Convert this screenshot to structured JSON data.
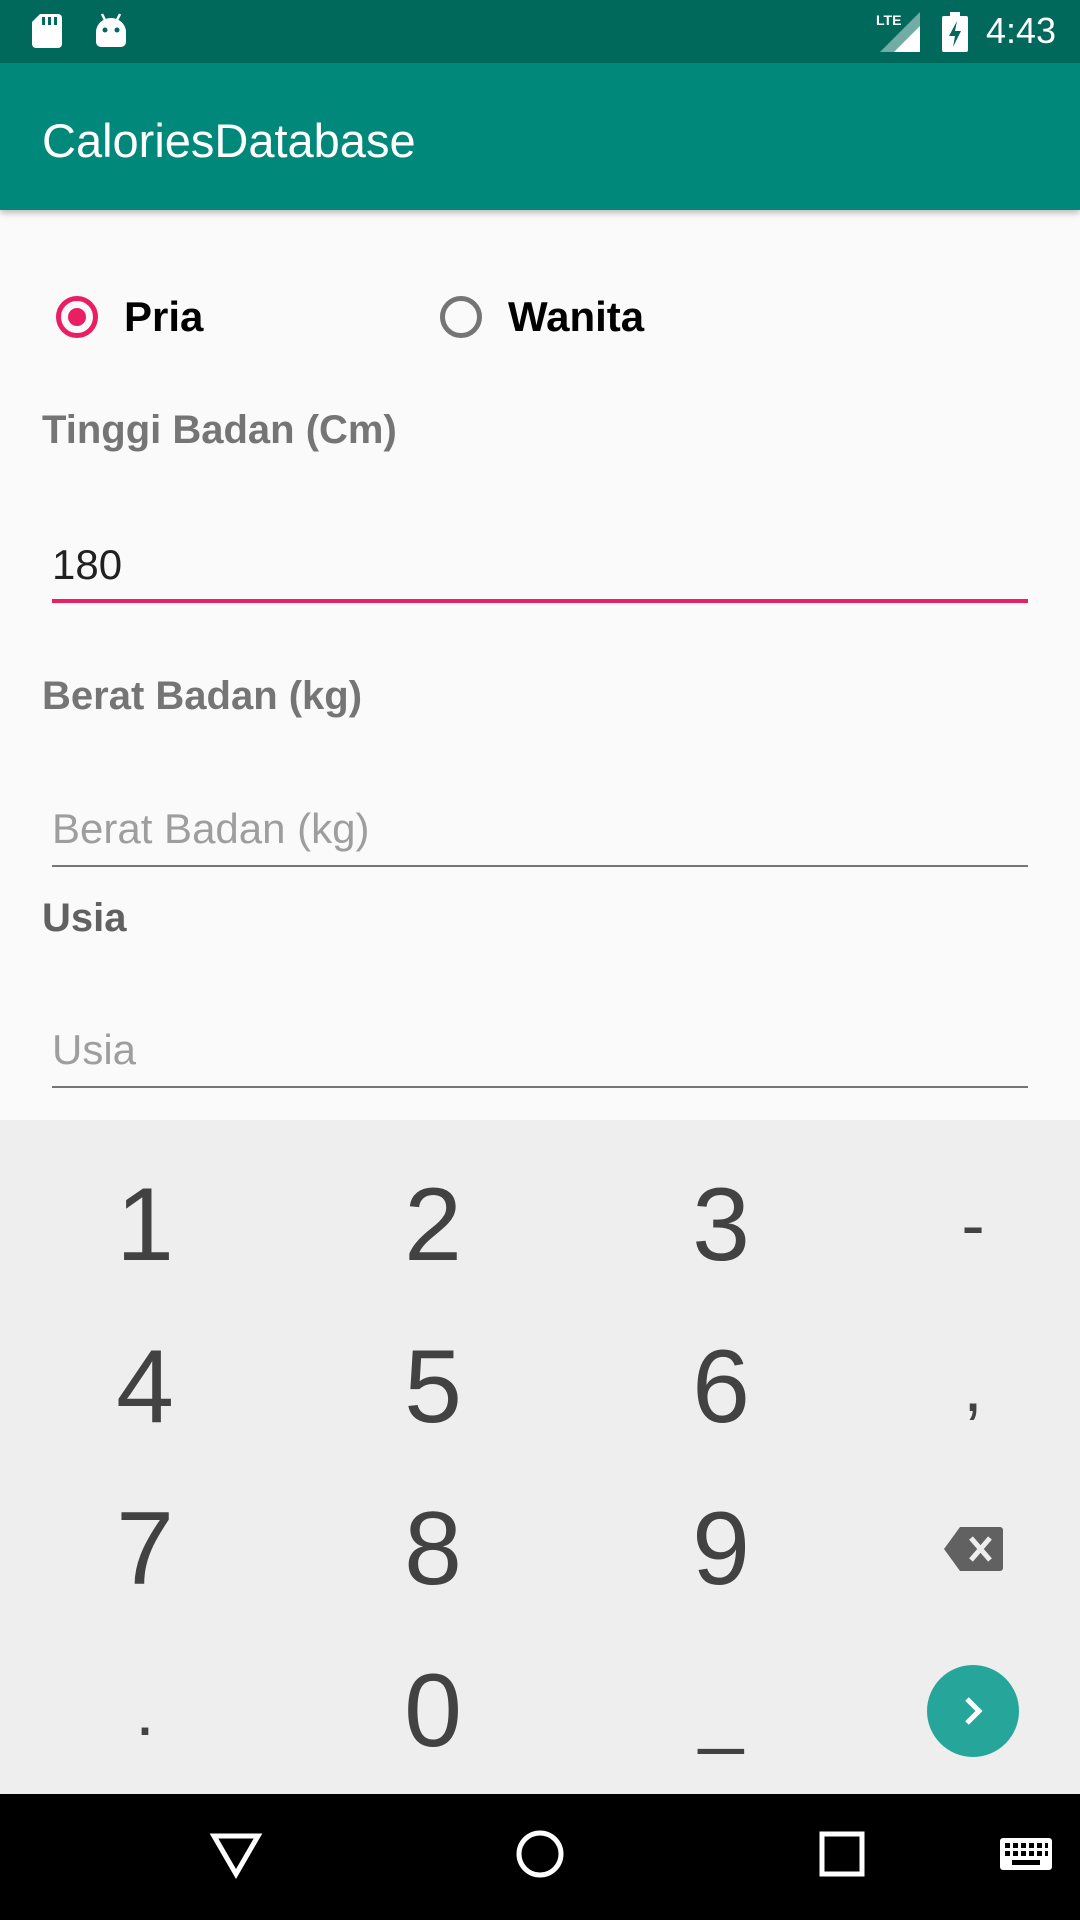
{
  "status_bar": {
    "time": "4:43",
    "network_label": "LTE",
    "icons": [
      "sd-card-icon",
      "android-icon",
      "lte-signal-icon",
      "battery-charging-icon"
    ]
  },
  "app_bar": {
    "title": "CaloriesDatabase",
    "color": "#00897b"
  },
  "gender": {
    "options": [
      {
        "label": "Pria",
        "checked": true
      },
      {
        "label": "Wanita",
        "checked": false
      }
    ]
  },
  "form": {
    "tinggi": {
      "label": "Tinggi Badan (Cm)",
      "value": "180",
      "placeholder": ""
    },
    "berat": {
      "label": "Berat Badan (kg)",
      "value": "",
      "placeholder": "Berat Badan (kg)"
    },
    "usia": {
      "label": "Usia",
      "value": "",
      "placeholder": "Usia"
    }
  },
  "keyboard": {
    "rows": [
      [
        "1",
        "2",
        "3",
        "-"
      ],
      [
        "4",
        "5",
        "6",
        ","
      ],
      [
        "7",
        "8",
        "9",
        "backspace-icon"
      ],
      [
        ".",
        "0",
        "_",
        "go-icon"
      ]
    ]
  },
  "nav_bar": {
    "buttons": [
      "back-icon",
      "home-icon",
      "recents-icon",
      "keyboard-switch-icon"
    ]
  },
  "colors": {
    "accent": "#e91e63",
    "primary_dark": "#00695c",
    "primary": "#00897b",
    "keyboard_action": "#26a69a"
  }
}
